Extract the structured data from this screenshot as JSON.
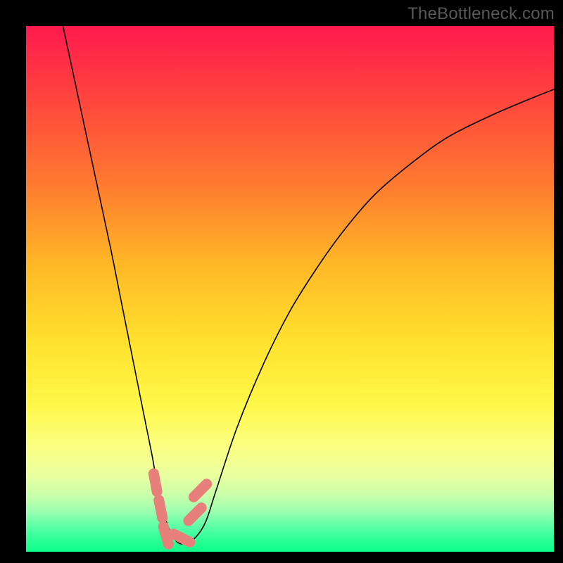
{
  "watermark": "TheBottleneck.com",
  "chart_data": {
    "type": "line",
    "title": "",
    "xlabel": "",
    "ylabel": "",
    "xlim": [
      0,
      100
    ],
    "ylim": [
      0,
      100
    ],
    "series": [
      {
        "name": "curve",
        "x": [
          7,
          10,
          13,
          16,
          18,
          20,
          22,
          24,
          25,
          26,
          27,
          28,
          29,
          30,
          32,
          34,
          36,
          40,
          45,
          50,
          55,
          60,
          66,
          73,
          80,
          88,
          95,
          100
        ],
        "y": [
          100,
          86,
          72,
          58,
          48,
          38,
          28,
          18,
          12,
          8,
          5,
          3,
          2,
          2,
          3,
          6,
          12,
          24,
          36,
          46,
          54,
          61,
          68,
          74,
          79,
          83,
          86,
          88
        ]
      }
    ],
    "markers": [
      {
        "x": 24.5,
        "y": 13.5
      },
      {
        "x": 25.5,
        "y": 8.5
      },
      {
        "x": 26.5,
        "y": 3.5
      },
      {
        "x": 29.5,
        "y": 3.0
      },
      {
        "x": 32.0,
        "y": 7.5
      },
      {
        "x": 33.0,
        "y": 12.0
      }
    ],
    "background_gradient": {
      "top": "#ff1a4e",
      "mid": "#ffe22e",
      "bottom": "#0aff8a"
    }
  }
}
